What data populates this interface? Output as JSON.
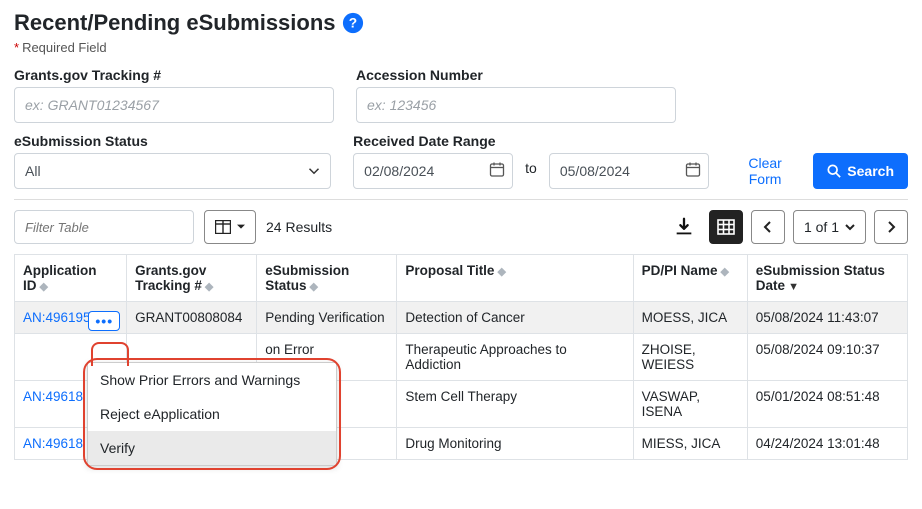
{
  "header": {
    "title": "Recent/Pending eSubmissions",
    "required_field": "Required Field"
  },
  "form": {
    "tracking_label": "Grants.gov Tracking #",
    "tracking_placeholder": "ex: GRANT01234567",
    "accession_label": "Accession Number",
    "accession_placeholder": "ex: 123456",
    "status_label": "eSubmission Status",
    "status_value": "All",
    "received_label": "Received Date Range",
    "date_from": "02/08/2024",
    "date_to_label": "to",
    "date_to": "05/08/2024",
    "clear": "Clear Form",
    "search": "Search"
  },
  "toolbar": {
    "filter_placeholder": "Filter Table",
    "results": "24 Results",
    "page_indicator": "1 of 1"
  },
  "table": {
    "headers": {
      "app_id": "Application ID",
      "tracking": "Grants.gov Tracking #",
      "esub_status": "eSubmission Status",
      "proposal": "Proposal Title",
      "pdpi": "PD/PI Name",
      "status_date": "eSubmission Status Date"
    },
    "rows": [
      {
        "app_id": "AN:4961954",
        "tracking": "GRANT00808084",
        "esub_status": "Pending Verification",
        "proposal": "Detection of Cancer",
        "pdpi": "MOESS, JICA",
        "date": "05/08/2024 11:43:07",
        "selected": true,
        "has_more": true
      },
      {
        "app_id": "",
        "tracking": "",
        "esub_status": "on Error",
        "proposal": "Therapeutic Approaches to Addiction",
        "pdpi": "ZHOISE, WEIESS",
        "date": "05/08/2024 09:10:37"
      },
      {
        "app_id": "AN:49618",
        "tracking": "",
        "esub_status": "",
        "proposal": "Stem Cell Therapy",
        "pdpi": "VASWAP, ISENA",
        "date": "05/01/2024 08:51:48"
      },
      {
        "app_id": "AN:49618",
        "tracking": "",
        "esub_status": "",
        "proposal": "Drug Monitoring",
        "pdpi": "MIESS, JICA",
        "date": "04/24/2024 13:01:48"
      }
    ]
  },
  "menu": {
    "items": [
      "Show Prior Errors and Warnings",
      "Reject eApplication",
      "Verify"
    ]
  }
}
